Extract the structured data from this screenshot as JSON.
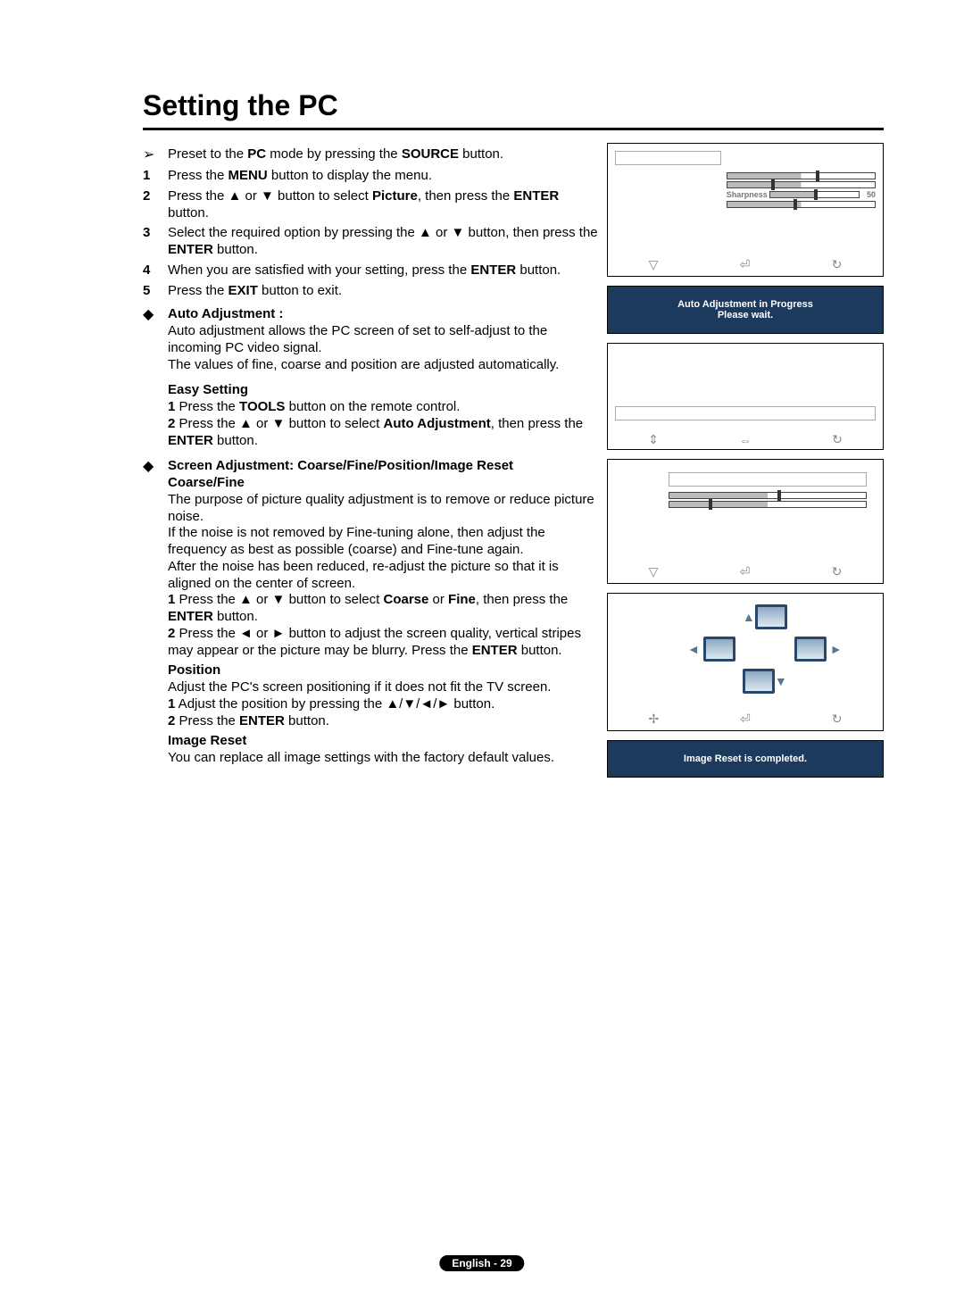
{
  "title": "Setting the PC",
  "preset": {
    "pre": "Preset to the ",
    "pc": "PC",
    "mid": " mode by pressing the ",
    "src": "SOURCE",
    "post": " button."
  },
  "steps": {
    "s1": {
      "n": "1",
      "pre": "Press the ",
      "b1": "MENU",
      "post": " button to display the menu."
    },
    "s2": {
      "n": "2",
      "pre": "Press the ▲ or ▼ button to select ",
      "b1": "Picture",
      "mid": ", then press the ",
      "b2": "ENTER",
      "post": " button."
    },
    "s3": {
      "n": "3",
      "pre": "Select the required option by pressing the ▲ or ▼ button, then press the ",
      "b1": "ENTER",
      "post": " button."
    },
    "s4": {
      "n": "4",
      "pre": "When you are satisfied with your setting, press the ",
      "b1": "ENTER",
      "post": " button."
    },
    "s5": {
      "n": "5",
      "pre": "Press the ",
      "b1": "EXIT",
      "post": " button to exit."
    }
  },
  "auto": {
    "heading": "Auto Adjustment :",
    "l1": "Auto adjustment allows the PC screen of set to self-adjust to the incoming PC video signal.",
    "l2": "The values of fine, coarse and position are adjusted automatically.",
    "easy_h": "Easy Setting",
    "e1n": "1",
    "e1pre": " Press the ",
    "e1b": "TOOLS",
    "e1post": " button on the remote control.",
    "e2n": "2",
    "e2pre": " Press the ▲ or ▼ button to select ",
    "e2b": "Auto Adjustment",
    "e2mid": ", then press the ",
    "e2b2": "ENTER",
    "e2post": " button."
  },
  "screen": {
    "heading": "Screen Adjustment: Coarse/Fine/Position/Image Reset",
    "cf_h": "Coarse/Fine",
    "l1": "The purpose of picture quality adjustment is to remove or reduce picture noise.",
    "l2": "If the noise is not removed by Fine-tuning alone, then adjust the frequency as best as possible (coarse) and Fine-tune again.",
    "l3": "After the noise has been reduced, re-adjust the picture so that it is aligned on the center of screen.",
    "c1n": "1",
    "c1pre": " Press the ▲ or ▼ button to select ",
    "c1b1": "Coarse",
    "c1mid": " or ",
    "c1b2": "Fine",
    "c1mid2": ", then press the ",
    "c1b3": "ENTER",
    "c1post": " button.",
    "c2n": "2",
    "c2pre": " Press the ◄ or ► button to adjust the screen quality, vertical stripes may appear or the picture may be blurry. Press the ",
    "c2b": "ENTER",
    "c2post": " button.",
    "pos_h": "Position",
    "pos_l": "Adjust the PC's screen positioning if it does not fit the TV screen.",
    "p1n": "1",
    "p1": " Adjust the position by pressing the ▲/▼/◄/► button.",
    "p2n": "2",
    "p2pre": " Press the ",
    "p2b": "ENTER",
    "p2post": " button.",
    "ir_h": "Image Reset",
    "ir_l": "You can replace all image settings with the factory default values."
  },
  "osd": {
    "sharpness_label": "Sharpness",
    "sharpness_value": "50",
    "autoadj_l1": "Auto Adjustment in Progress",
    "autoadj_l2": "Please wait.",
    "imgreset": "Image Reset is completed."
  },
  "footer": "English - 29"
}
